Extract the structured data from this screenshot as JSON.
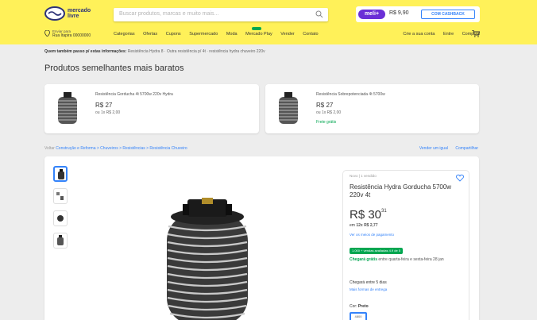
{
  "header": {
    "logo_line1": "mercado",
    "logo_line2": "livre",
    "search_placeholder": "Buscar produtos, marcas e muito mais...",
    "promo": {
      "badge": "meli+",
      "price": "R$ 9,90",
      "cta": "COM CASHBACK"
    },
    "location": {
      "line1": "Enviar para",
      "line2": "Rua Itapira 00000000"
    },
    "nav_items": [
      "Categorias",
      "Ofertas",
      "Cupons",
      "Supermercado",
      "Moda",
      "Mercado Play",
      "Vender",
      "Contato"
    ],
    "account_items": [
      "Crie a sua conta",
      "Entre",
      "Compras"
    ]
  },
  "related": {
    "header_prefix": "Quem também passo p/ estas informações:",
    "header_rest": "Resistência Hydra 8 · Outra resistência p/ 4t · resistência hydra chuveiro 220v",
    "section_title": "Produtos semelhantes mais baratos",
    "cards": [
      {
        "title": "Resistência Gorducha 4t 5700w 220v Hydra",
        "price": "R$ 27",
        "old": "ou 1x R$ 2,00",
        "ship": ""
      },
      {
        "title": "Resistência Sobrepotenciada 4t 5700w",
        "price": "R$ 27",
        "old": "ou 1x R$ 2,00",
        "ship": "Frete grátis"
      }
    ]
  },
  "breadcrumb": {
    "back": "Voltar",
    "items": "Construção e Reforma > Chuveiros > Resistências > Resistência Chuveiro",
    "right": [
      "Vender um igual",
      "Compartilhar"
    ]
  },
  "product": {
    "condition": "Novo | 1 vendido",
    "title": "Resistência Hydra Gorducha 5700w 220v 4t",
    "price": "R$ 30",
    "cents": "31",
    "installments_prefix": "em",
    "installments_value": "12x R$ 2,77",
    "payment_link": "Ver os meios de pagamento",
    "badge": "1.000 + vendas avaliadas 4.9 de 5",
    "ship_main": "Chegará grátis",
    "ship_rest": "entre quarta-feira e sexta-feira 28 jan",
    "arrive": "Chegará entre 5 dias",
    "more_link": "Mais formas de entrega",
    "color_label": "Cor:",
    "color_value": "Preto",
    "swatch": "4800"
  },
  "colors": {
    "header_bg": "#fff159",
    "brand_blue": "#2d3277",
    "link_blue": "#3483fa",
    "green": "#00a650",
    "meli_purple": "#6a2fd6"
  }
}
